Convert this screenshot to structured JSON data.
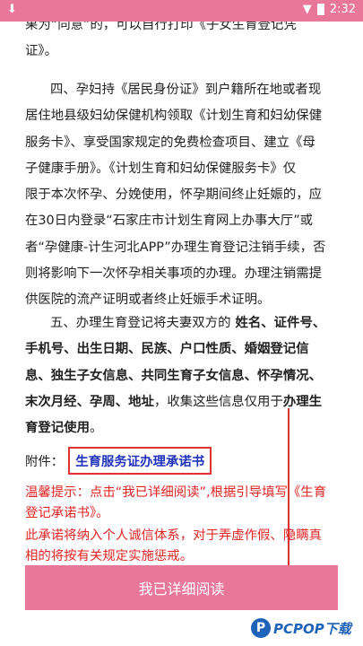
{
  "status_bar": {
    "time": "2:32",
    "download_icon": "download-icon",
    "wifi_icon": "wifi-icon"
  },
  "paragraph_top": {
    "line1": "果为“同意”的，可以自行打印《子女生育登记凭",
    "line2": "证》。"
  },
  "paragraph_4": {
    "line1": "四、孕妇持《居民身份证》到户籍所在地或者现",
    "line2": "居住地县级妇幼保健机构领取《计划生育和妇幼保健",
    "line3": "服务卡》、享受国家规定的免费检查项目、建立《母",
    "line4": "子健康手册》。《计划生育和妇幼保健服务卡》仅",
    "line5": "限于本次怀孕、分娩使用，怀孕期间终止妊娠的，应",
    "line6": "在30日内登录“石家庄市计划生育网上办事大厅”或",
    "line7": "者“孕健康-计生河北APP”办理生育登记注销手续，否",
    "line8": "则将影响下一次怀孕相关事项的办理。办理注销需提",
    "line9": "供医院的流产证明或者终止妊娠手术证明。"
  },
  "paragraph_5": {
    "line1_plain": "五、办理生育登记将夫妻双方的",
    "line1_bold": " 姓名、证件号、",
    "line2_bold": "手机号、出生日期、民族、户口性质、婚姻登记信",
    "line3_bold": "息、独生子女信息、共同生育子女信息、怀孕情况、",
    "line4_bold": "末次月经、孕周、地址",
    "line4_plain": "，收集这些信息仅用于",
    "line4_bold2": "办理生",
    "line5_bold": "育登记使用",
    "line5_plain": "。"
  },
  "attachment": {
    "label": "附件：",
    "link": "生育服务证办理承诺书"
  },
  "tip": {
    "line1": "温馨提示：点击“我已详细阅读”,根据引导填写《生育",
    "line2": "登记承诺书》。"
  },
  "pledge": {
    "line1": "此承诺将纳入个人诚信体系，对于弄虚作假、隐瞒真",
    "line2": "相的将按有关规定实施惩戒。"
  },
  "read_button": {
    "label": "我已详细阅读"
  },
  "watermark": {
    "logo": "P",
    "text": "PCPOP下载"
  },
  "colors": {
    "accent": "#e8779a",
    "red_text": "#e02525",
    "link": "#2233bb"
  }
}
